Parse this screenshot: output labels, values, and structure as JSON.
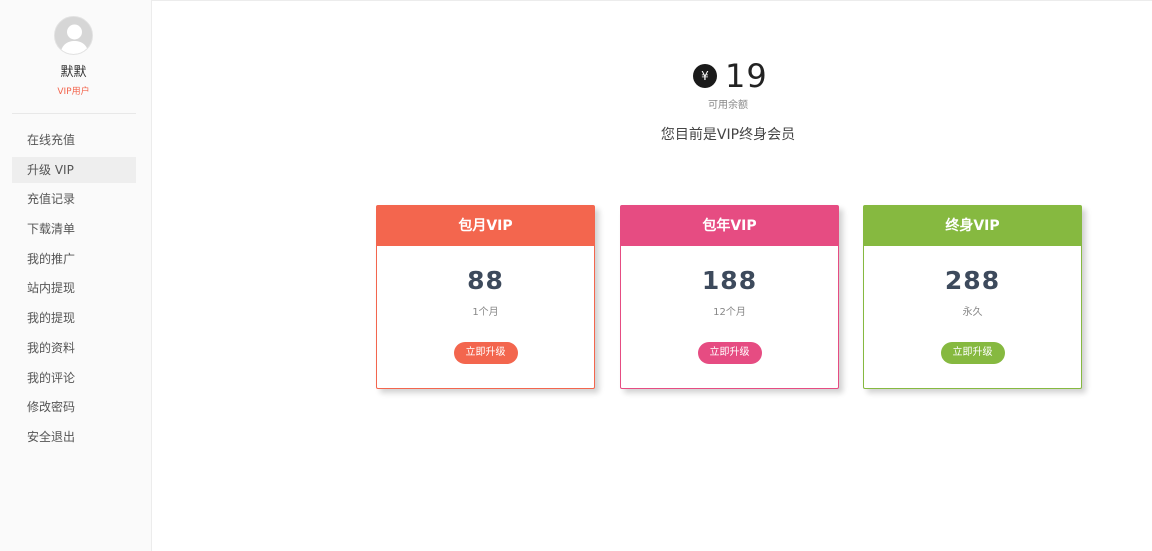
{
  "user": {
    "name": "默默",
    "role": "VIP用户"
  },
  "sidebar": {
    "items": [
      {
        "label": "在线充值"
      },
      {
        "label": "升级 VIP"
      },
      {
        "label": "充值记录"
      },
      {
        "label": "下载清单"
      },
      {
        "label": "我的推广"
      },
      {
        "label": "站内提现"
      },
      {
        "label": "我的提现"
      },
      {
        "label": "我的资料"
      },
      {
        "label": "我的评论"
      },
      {
        "label": "修改密码"
      },
      {
        "label": "安全退出"
      }
    ],
    "active_index": 1
  },
  "balance": {
    "icon": "yen-icon",
    "icon_glyph": "¥",
    "value": "19",
    "label": "可用余额"
  },
  "member_status": "您目前是VIP终身会员",
  "plans": [
    {
      "title": "包月VIP",
      "price": "88",
      "period": "1个月",
      "button": "立即升级",
      "color": "#f3664e"
    },
    {
      "title": "包年VIP",
      "price": "188",
      "period": "12个月",
      "button": "立即升级",
      "color": "#e64c82"
    },
    {
      "title": "终身VIP",
      "price": "288",
      "period": "永久",
      "button": "立即升级",
      "color": "#86b940"
    }
  ]
}
